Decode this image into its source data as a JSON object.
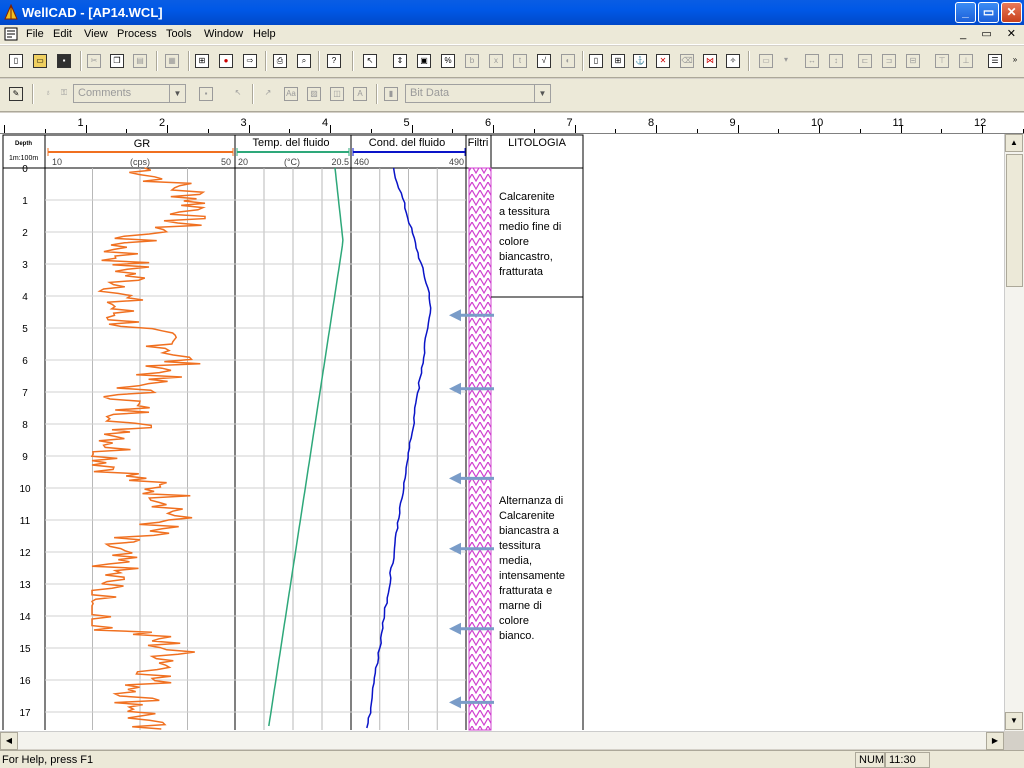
{
  "window": {
    "title": "WellCAD - [AP14.WCL]",
    "minimize": "_",
    "restore": "▭",
    "close": "✕"
  },
  "menu": [
    "File",
    "Edit",
    "View",
    "Process",
    "Tools",
    "Window",
    "Help"
  ],
  "mdi_controls": "_ ▭ ✕",
  "toolbar2": {
    "comments_combo": "Comments",
    "bitdata_combo": "Bit Data"
  },
  "ruler": {
    "labels": [
      "1",
      "2",
      "3",
      "4",
      "5",
      "6",
      "7",
      "8",
      "9",
      "10",
      "11",
      "12"
    ]
  },
  "log": {
    "depth_header": "Depth",
    "scale": "1m:100m",
    "gr": {
      "title": "GR",
      "min": "10",
      "unit": "(cps)",
      "max": "50",
      "color": "#f07020"
    },
    "temp": {
      "title": "Temp. del fluido",
      "min": "20",
      "unit": "(°C)",
      "max": "20.5",
      "color": "#2ea87a"
    },
    "cond": {
      "title": "Cond. del fluido",
      "min": "460",
      "max": "490",
      "color": "#0a14c8"
    },
    "filtri": {
      "title": "Filtri",
      "color": "#d040d0"
    },
    "litologia": {
      "title": "LITOLOGIA",
      "unit1": [
        "Calcarenite",
        "a tessitura",
        "medio fine di",
        "colore",
        "biancastro,",
        "fratturata"
      ],
      "unit2": [
        "Alternanza di",
        "Calcarenite",
        "biancastra a",
        "tessitura",
        "media,",
        "intensamente",
        "fratturata e",
        "marne di",
        "colore",
        "bianco."
      ]
    },
    "depth_labels": [
      "0",
      "1",
      "2",
      "3",
      "4",
      "5",
      "6",
      "7",
      "8",
      "9",
      "10",
      "11",
      "12",
      "13",
      "14",
      "15",
      "16",
      "17"
    ],
    "filter_arrow_depths": [
      4.6,
      6.9,
      9.7,
      11.9,
      14.4,
      16.7
    ]
  },
  "status": {
    "help": "For Help, press F1",
    "num": "NUM",
    "time": "11:30"
  }
}
